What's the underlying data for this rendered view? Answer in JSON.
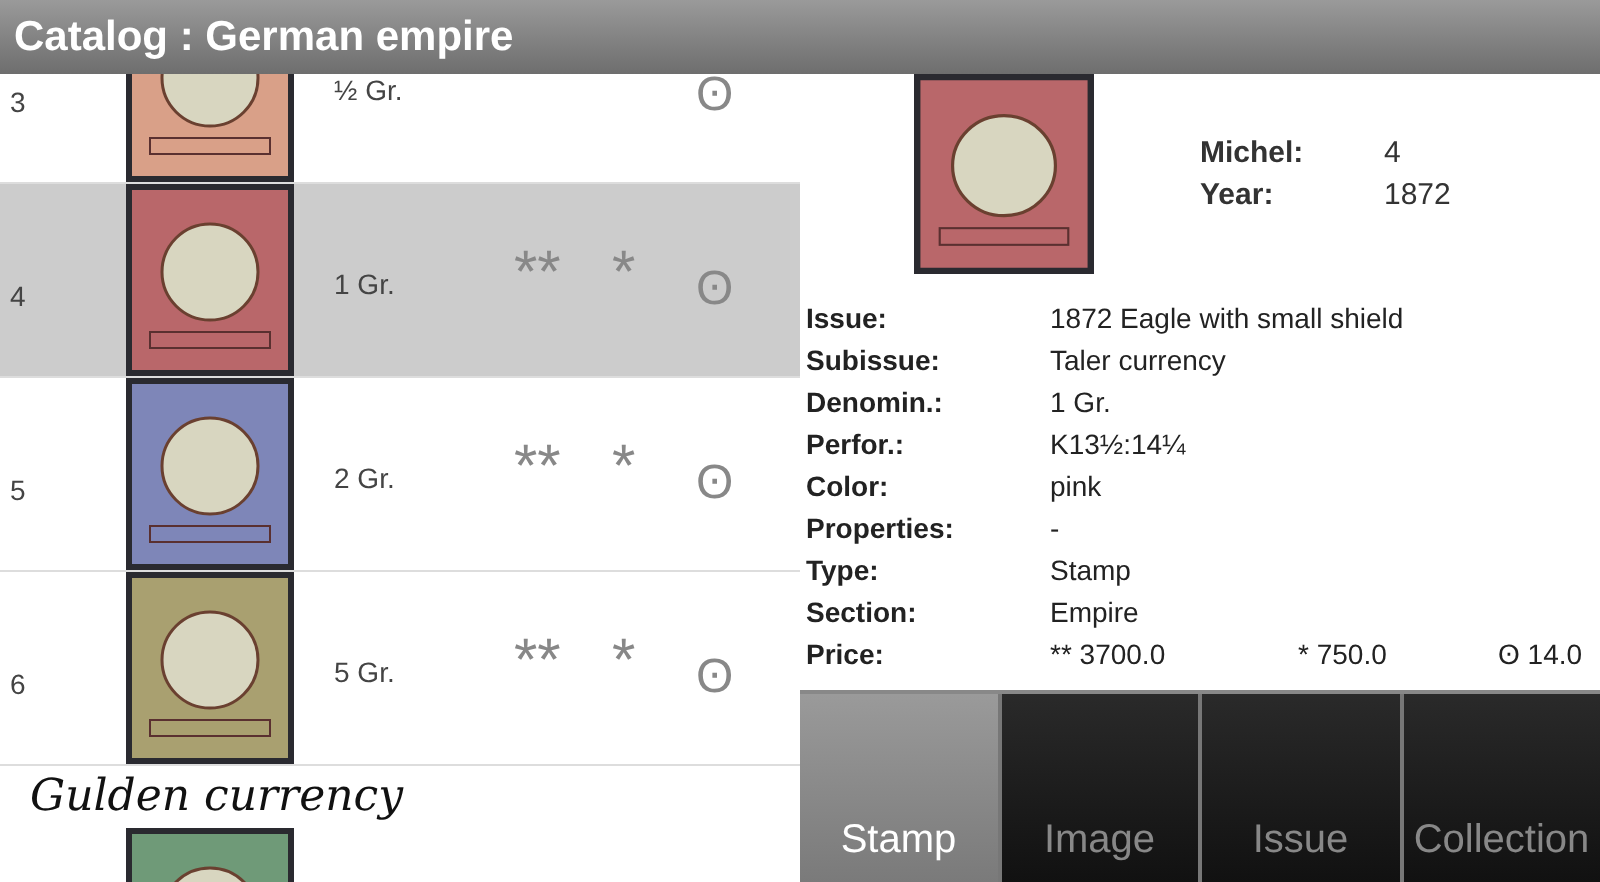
{
  "title": "Catalog : German empire",
  "list": [
    {
      "kind": "stamp",
      "number": "3",
      "color": "#d9a088",
      "denomination": "½ Gr.",
      "used": "ʘ",
      "selected": false
    },
    {
      "kind": "stamp",
      "number": "4",
      "color": "#b9676a",
      "denomination": "1 Gr.",
      "mint": "**",
      "hinged": "*",
      "used": "ʘ",
      "selected": true
    },
    {
      "kind": "stamp",
      "number": "5",
      "color": "#7e86b8",
      "denomination": "2 Gr.",
      "mint": "**",
      "hinged": "*",
      "used": "ʘ",
      "selected": false
    },
    {
      "kind": "stamp",
      "number": "6",
      "color": "#a9a070",
      "denomination": "5 Gr.",
      "mint": "**",
      "hinged": "*",
      "used": "ʘ",
      "selected": false
    },
    {
      "kind": "section",
      "label": "Gulden currency"
    },
    {
      "kind": "stamp",
      "color": "#6f9a78",
      "selected": false
    }
  ],
  "detail": {
    "stamp": {
      "color": "#b9676a"
    },
    "header": [
      {
        "label": "Michel:",
        "value": "4"
      },
      {
        "label": "Year:",
        "value": "1872"
      }
    ],
    "fields": [
      {
        "label": "Issue:",
        "values": [
          "1872 Eagle with small shield"
        ]
      },
      {
        "label": "Subissue:",
        "values": [
          "Taler currency"
        ]
      },
      {
        "label": "Denomin.:",
        "values": [
          "1 Gr."
        ]
      },
      {
        "label": "Perfor.:",
        "values": [
          "K13½:14¼"
        ]
      },
      {
        "label": "Color:",
        "values": [
          "pink"
        ]
      },
      {
        "label": "Properties:",
        "values": [
          "-"
        ]
      },
      {
        "label": "Type:",
        "values": [
          "Stamp"
        ]
      },
      {
        "label": "Section:",
        "values": [
          "Empire"
        ]
      },
      {
        "label": "Price:",
        "values": [
          "** 3700.0",
          "* 750.0",
          "ʘ 14.0"
        ]
      }
    ]
  },
  "tabs": [
    {
      "label": "Stamp",
      "selected": true
    },
    {
      "label": "Image",
      "selected": false
    },
    {
      "label": "Issue",
      "selected": false
    },
    {
      "label": "Collection",
      "selected": false
    }
  ]
}
